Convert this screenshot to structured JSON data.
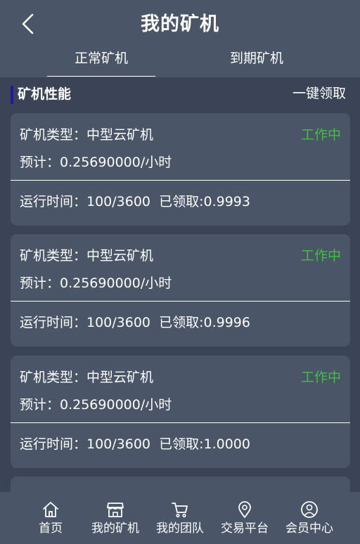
{
  "header": {
    "title": "我的矿机"
  },
  "tabs": [
    {
      "label": "正常矿机",
      "active": true
    },
    {
      "label": "到期矿机",
      "active": false
    }
  ],
  "section": {
    "title": "矿机性能",
    "claim_all_label": "一键领取",
    "accent_color": "#1e1b9e"
  },
  "miners": [
    {
      "type_label": "矿机类型：中型云矿机",
      "status": "工作中",
      "estimate": "预计：0.25690000/小时",
      "runtime_line": "运行时间：100/3600  已领取:0.9993"
    },
    {
      "type_label": "矿机类型：中型云矿机",
      "status": "工作中",
      "estimate": "预计：0.25690000/小时",
      "runtime_line": "运行时间：100/3600  已领取:0.9996"
    },
    {
      "type_label": "矿机类型：中型云矿机",
      "status": "工作中",
      "estimate": "预计：0.25690000/小时",
      "runtime_line": "运行时间：100/3600  已领取:1.0000"
    }
  ],
  "status_color": "#3ec13e",
  "bottom_nav": [
    {
      "label": "首页",
      "icon": "home-icon"
    },
    {
      "label": "我的矿机",
      "icon": "store-icon"
    },
    {
      "label": "我的团队",
      "icon": "cart-icon"
    },
    {
      "label": "交易平台",
      "icon": "location-pin-icon"
    },
    {
      "label": "会员中心",
      "icon": "user-circle-icon"
    }
  ]
}
